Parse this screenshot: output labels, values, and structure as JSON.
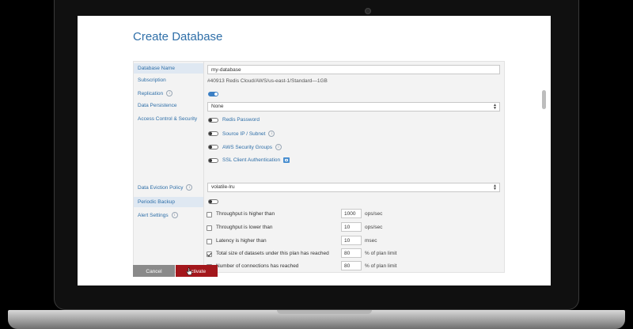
{
  "page": {
    "title": "Create Database"
  },
  "labels": {
    "database_name": "Database Name",
    "subscription": "Subscription",
    "replication": "Replication",
    "data_persistence": "Data Persistence",
    "access_control": "Access Control & Security",
    "eviction_policy": "Data Eviction Policy",
    "periodic_backup": "Periodic Backup",
    "alert_settings": "Alert Settings"
  },
  "fields": {
    "database_name_value": "my-database",
    "subscription_value": "#40913 Redis Cloud/AWS/us-east-1/Standard—1GB",
    "replication_on": true,
    "data_persistence_value": "None",
    "eviction_policy_value": "volatile-lru",
    "periodic_backup_on": false
  },
  "access_options": [
    {
      "label": "Redis Password",
      "on": false
    },
    {
      "label": "Source IP / Subnet",
      "on": false
    },
    {
      "label": "AWS Security Groups",
      "on": false
    },
    {
      "label": "SSL Client Authentication",
      "on": false
    }
  ],
  "alerts": [
    {
      "label": "Throughput is higher than",
      "checked": false,
      "value": "1000",
      "unit": "ops/sec"
    },
    {
      "label": "Throughput is lower than",
      "checked": false,
      "value": "10",
      "unit": "ops/sec"
    },
    {
      "label": "Latency is higher than",
      "checked": false,
      "value": "10",
      "unit": "msec"
    },
    {
      "label": "Total size of datasets under this plan has reached",
      "checked": true,
      "value": "80",
      "unit": "% of plan limit"
    },
    {
      "label": "Number of connections has reached",
      "checked": true,
      "value": "80",
      "unit": "% of plan limit"
    }
  ],
  "buttons": {
    "cancel": "Cancel",
    "activate": "Activate"
  },
  "colors": {
    "accent": "#2f6fa8",
    "activate": "#a3171c",
    "cancel": "#8a8a8a",
    "toggle_on": "#3b7fc4"
  },
  "icons": {
    "info": "info-icon",
    "edit": "edit-icon",
    "dropdown": "chevron-updown-icon"
  }
}
